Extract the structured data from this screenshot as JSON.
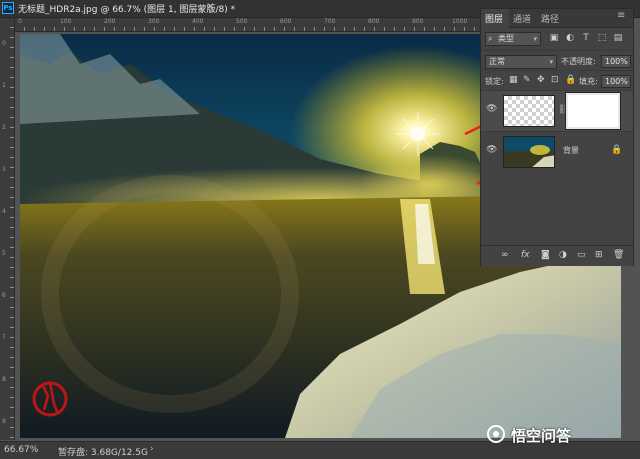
{
  "window": {
    "title": "无标题_HDR2a.jpg @ 66.7% (图层 1, 图层蒙版/8) *",
    "close_glyph": "×",
    "app_icon": "Ps"
  },
  "status": {
    "zoom": "66.67%",
    "doc_size": "暂存盘: 3.68G/12.5G",
    "arrow": "›"
  },
  "ruler": {
    "top_marks": [
      "0",
      "100",
      "200",
      "300",
      "400",
      "500",
      "600",
      "700",
      "800",
      "900",
      "1000"
    ],
    "left_marks": [
      "0",
      "1",
      "2",
      "3",
      "4",
      "5",
      "6",
      "7",
      "8",
      "9"
    ]
  },
  "layers_panel": {
    "tabs": [
      "图层",
      "通道",
      "路径"
    ],
    "active_tab": 0,
    "kind_filter": "类型",
    "search_icon": "search-icon",
    "blend_mode": "正常",
    "opacity_label": "不透明度:",
    "opacity_value": "100%",
    "lock_label": "锁定:",
    "fill_label": "填充:",
    "fill_value": "100%",
    "layers": [
      {
        "name": "",
        "type": "layer-with-mask",
        "visible": true
      },
      {
        "name": "背景",
        "type": "background",
        "visible": true,
        "locked": true
      }
    ],
    "footer_icons": [
      "link-icon",
      "fx-icon",
      "mask-icon",
      "adjustment-icon",
      "folder-icon",
      "new-layer-icon",
      "trash-icon"
    ],
    "fx_label": "fx"
  },
  "watermark": {
    "brand": "悟空问答"
  },
  "colors": {
    "accent_arrow": "#e8212a",
    "ps_blue": "#31a8ff"
  }
}
